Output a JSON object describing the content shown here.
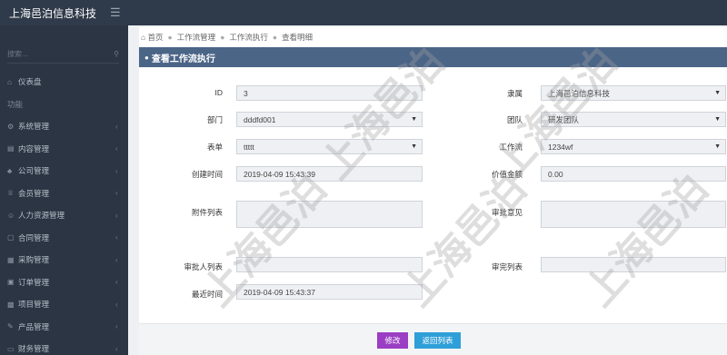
{
  "app": {
    "brand": "上海邑泊信息科技"
  },
  "sidebar": {
    "search_placeholder": "搜索...",
    "items": [
      {
        "label": "仪表盘",
        "icon": "home-icon"
      },
      {
        "label": "功能",
        "section": true
      },
      {
        "label": "系统管理",
        "icon": "gears-icon"
      },
      {
        "label": "内容管理",
        "icon": "list-icon"
      },
      {
        "label": "公司管理",
        "icon": "sitemap-icon"
      },
      {
        "label": "会员管理",
        "icon": "trophy-icon"
      },
      {
        "label": "人力资源管理",
        "icon": "users-icon"
      },
      {
        "label": "合同管理",
        "icon": "file-icon"
      },
      {
        "label": "采购管理",
        "icon": "cart-icon"
      },
      {
        "label": "订单管理",
        "icon": "order-icon"
      },
      {
        "label": "项目管理",
        "icon": "project-icon"
      },
      {
        "label": "产品管理",
        "icon": "edit-icon"
      },
      {
        "label": "财务管理",
        "icon": "money-icon"
      }
    ]
  },
  "breadcrumb": [
    "首页",
    "工作流管理",
    "工作流执行",
    "查看明细"
  ],
  "panel_title": "查看工作流执行",
  "form": {
    "id_label": "ID",
    "id_value": "3",
    "owner_label": "隶属",
    "owner_value": "上海邑泊信息科技",
    "dept_label": "部门",
    "dept_value": "dddfd001",
    "team_label": "团队",
    "team_value": "研发团队",
    "form_label": "表单",
    "form_value": "ttttt",
    "workflow_label": "工作流",
    "workflow_value": "1234wf",
    "created_label": "创建时间",
    "created_value": "2019-04-09 15:43:39",
    "amount_label": "价值金额",
    "amount_value": "0.00",
    "attach_label": "附件列表",
    "attach_value": "",
    "opinion_label": "审批意见",
    "opinion_value": "",
    "approvers_label": "审批人列表",
    "approvers_value": "",
    "done_label": "审完列表",
    "done_value": "",
    "updated_label": "最近时间",
    "updated_value": "2019-04-09 15:43:37"
  },
  "buttons": {
    "edit": "修改",
    "back": "返回列表"
  },
  "watermark": "上海邑泊"
}
